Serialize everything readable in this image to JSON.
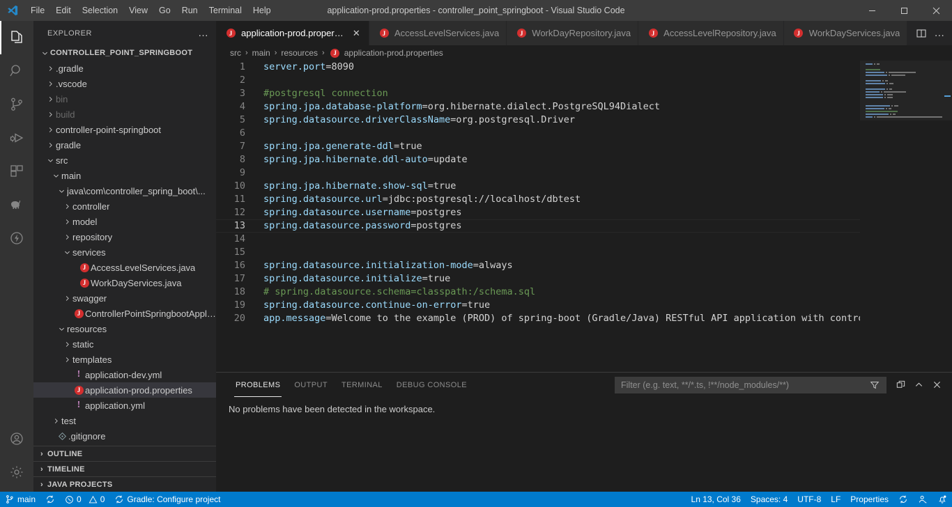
{
  "window": {
    "title": "application-prod.properties - controller_point_springboot - Visual Studio Code",
    "minimize_label": "─",
    "maximize_label": "❐",
    "close_label": "✕"
  },
  "menu": {
    "items": [
      {
        "label": "File",
        "name": "menu-file"
      },
      {
        "label": "Edit",
        "name": "menu-edit"
      },
      {
        "label": "Selection",
        "name": "menu-selection"
      },
      {
        "label": "View",
        "name": "menu-view"
      },
      {
        "label": "Go",
        "name": "menu-go"
      },
      {
        "label": "Run",
        "name": "menu-run"
      },
      {
        "label": "Terminal",
        "name": "menu-terminal"
      },
      {
        "label": "Help",
        "name": "menu-help"
      }
    ]
  },
  "activitybar": {
    "top": [
      {
        "icon": "explorer-icon",
        "active": true
      },
      {
        "icon": "search-icon",
        "active": false
      },
      {
        "icon": "source-control-icon",
        "active": false
      },
      {
        "icon": "run-and-debug-icon",
        "active": false
      },
      {
        "icon": "extensions-icon",
        "active": false
      },
      {
        "icon": "gradle-elephant-icon",
        "active": false
      },
      {
        "icon": "thunder-client-icon",
        "active": false
      }
    ],
    "bottom": [
      {
        "icon": "account-icon"
      },
      {
        "icon": "settings-gear-icon"
      }
    ]
  },
  "sidebar": {
    "title": "EXPLORER",
    "more_label": "…",
    "root": "CONTROLLER_POINT_SPRINGBOOT",
    "tree": [
      {
        "label": "CONTROLLER_POINT_SPRINGBOOT",
        "depth": 0,
        "type": "root",
        "expanded": true,
        "dim": false
      },
      {
        "label": ".gradle",
        "depth": 1,
        "type": "folder",
        "expanded": false,
        "dim": false
      },
      {
        "label": ".vscode",
        "depth": 1,
        "type": "folder",
        "expanded": false,
        "dim": false
      },
      {
        "label": "bin",
        "depth": 1,
        "type": "folder",
        "expanded": false,
        "dim": true
      },
      {
        "label": "build",
        "depth": 1,
        "type": "folder",
        "expanded": false,
        "dim": true
      },
      {
        "label": "controller-point-springboot",
        "depth": 1,
        "type": "folder",
        "expanded": false,
        "dim": false
      },
      {
        "label": "gradle",
        "depth": 1,
        "type": "folder",
        "expanded": false,
        "dim": false
      },
      {
        "label": "src",
        "depth": 1,
        "type": "folder",
        "expanded": true,
        "dim": false
      },
      {
        "label": "main",
        "depth": 2,
        "type": "folder",
        "expanded": true,
        "dim": false
      },
      {
        "label": "java\\com\\controller_spring_boot\\...",
        "depth": 3,
        "type": "folder",
        "expanded": true,
        "dim": false
      },
      {
        "label": "controller",
        "depth": 4,
        "type": "folder",
        "expanded": false,
        "dim": false
      },
      {
        "label": "model",
        "depth": 4,
        "type": "folder",
        "expanded": false,
        "dim": false
      },
      {
        "label": "repository",
        "depth": 4,
        "type": "folder",
        "expanded": false,
        "dim": false
      },
      {
        "label": "services",
        "depth": 4,
        "type": "folder",
        "expanded": true,
        "dim": false
      },
      {
        "label": "AccessLevelServices.java",
        "depth": 5,
        "type": "java",
        "expanded": false,
        "dim": false
      },
      {
        "label": "WorkDayServices.java",
        "depth": 5,
        "type": "java",
        "expanded": false,
        "dim": false
      },
      {
        "label": "swagger",
        "depth": 4,
        "type": "folder",
        "expanded": false,
        "dim": false
      },
      {
        "label": "ControllerPointSpringbootApplica...",
        "depth": 4,
        "type": "java",
        "expanded": false,
        "dim": false
      },
      {
        "label": "resources",
        "depth": 3,
        "type": "folder",
        "expanded": true,
        "dim": false
      },
      {
        "label": "static",
        "depth": 4,
        "type": "folder",
        "expanded": false,
        "dim": false
      },
      {
        "label": "templates",
        "depth": 4,
        "type": "folder",
        "expanded": false,
        "dim": false
      },
      {
        "label": "application-dev.yml",
        "depth": 4,
        "type": "yml",
        "expanded": false,
        "dim": false
      },
      {
        "label": "application-prod.properties",
        "depth": 4,
        "type": "java",
        "expanded": false,
        "dim": false,
        "selected": true
      },
      {
        "label": "application.yml",
        "depth": 4,
        "type": "yml",
        "expanded": false,
        "dim": false
      },
      {
        "label": "test",
        "depth": 2,
        "type": "folder",
        "expanded": false,
        "dim": false
      },
      {
        "label": ".gitignore",
        "depth": 1,
        "type": "git",
        "expanded": false,
        "dim": false
      }
    ],
    "sections": [
      {
        "label": "OUTLINE"
      },
      {
        "label": "TIMELINE"
      },
      {
        "label": "JAVA PROJECTS"
      }
    ]
  },
  "tabs": {
    "items": [
      {
        "label": "application-prod.properties",
        "icon": "java-file-icon",
        "active": true,
        "close_label": "✕"
      },
      {
        "label": "AccessLevelServices.java",
        "icon": "java-file-icon",
        "active": false
      },
      {
        "label": "WorkDayRepository.java",
        "icon": "java-file-icon",
        "active": false
      },
      {
        "label": "AccessLevelRepository.java",
        "icon": "java-file-icon",
        "active": false
      },
      {
        "label": "WorkDayServices.java",
        "icon": "java-file-icon",
        "active": false
      }
    ],
    "actions": [
      {
        "icon": "split-editor-icon"
      },
      {
        "icon": "more-actions-icon",
        "label": "…"
      }
    ]
  },
  "breadcrumbs": {
    "items": [
      "src",
      "main",
      "resources",
      "application-prod.properties"
    ],
    "separator": "›",
    "file_icon": "java-file-icon"
  },
  "editor": {
    "lines": [
      {
        "n": 1,
        "tokens": [
          {
            "t": "server.port",
            "c": "k"
          },
          {
            "t": "=",
            "c": "eq"
          },
          {
            "t": "8090",
            "c": "v"
          }
        ]
      },
      {
        "n": 2,
        "tokens": []
      },
      {
        "n": 3,
        "tokens": [
          {
            "t": "#postgresql connection",
            "c": "cm"
          }
        ]
      },
      {
        "n": 4,
        "tokens": [
          {
            "t": "spring.jpa.database-platform",
            "c": "k"
          },
          {
            "t": "=",
            "c": "eq"
          },
          {
            "t": "org.hibernate.dialect.PostgreSQL94Dialect",
            "c": "v"
          }
        ]
      },
      {
        "n": 5,
        "tokens": [
          {
            "t": "spring.datasource.driverClassName",
            "c": "k"
          },
          {
            "t": "=",
            "c": "eq"
          },
          {
            "t": "org.postgresql.Driver",
            "c": "v"
          }
        ]
      },
      {
        "n": 6,
        "tokens": []
      },
      {
        "n": 7,
        "tokens": [
          {
            "t": "spring.jpa.generate-ddl",
            "c": "k"
          },
          {
            "t": "=",
            "c": "eq"
          },
          {
            "t": "true",
            "c": "v"
          }
        ]
      },
      {
        "n": 8,
        "tokens": [
          {
            "t": "spring.jpa.hibernate.ddl-auto",
            "c": "k"
          },
          {
            "t": "=",
            "c": "eq"
          },
          {
            "t": "update",
            "c": "v"
          }
        ]
      },
      {
        "n": 9,
        "tokens": []
      },
      {
        "n": 10,
        "tokens": [
          {
            "t": "spring.jpa.hibernate.show-sql",
            "c": "k"
          },
          {
            "t": "=",
            "c": "eq"
          },
          {
            "t": "true",
            "c": "v"
          }
        ]
      },
      {
        "n": 11,
        "tokens": [
          {
            "t": "spring.datasource.url",
            "c": "k"
          },
          {
            "t": "=",
            "c": "eq"
          },
          {
            "t": "jdbc:postgresql://localhost/dbtest",
            "c": "v"
          }
        ]
      },
      {
        "n": 12,
        "tokens": [
          {
            "t": "spring.datasource.username",
            "c": "k"
          },
          {
            "t": "=",
            "c": "eq"
          },
          {
            "t": "postgres",
            "c": "v"
          }
        ]
      },
      {
        "n": 13,
        "tokens": [
          {
            "t": "spring.datasource.password",
            "c": "k"
          },
          {
            "t": "=",
            "c": "eq"
          },
          {
            "t": "postgres",
            "c": "v"
          }
        ],
        "current": true
      },
      {
        "n": 14,
        "tokens": []
      },
      {
        "n": 15,
        "tokens": []
      },
      {
        "n": 16,
        "tokens": [
          {
            "t": "spring.datasource.initialization-mode",
            "c": "k"
          },
          {
            "t": "=",
            "c": "eq"
          },
          {
            "t": "always",
            "c": "v"
          }
        ]
      },
      {
        "n": 17,
        "tokens": [
          {
            "t": "spring.datasource.initialize",
            "c": "k"
          },
          {
            "t": "=",
            "c": "eq"
          },
          {
            "t": "true",
            "c": "v"
          }
        ]
      },
      {
        "n": 18,
        "tokens": [
          {
            "t": "# spring.datasource.schema=classpath:/schema.sql",
            "c": "cm"
          }
        ]
      },
      {
        "n": 19,
        "tokens": [
          {
            "t": "spring.datasource.continue-on-error",
            "c": "k"
          },
          {
            "t": "=",
            "c": "eq"
          },
          {
            "t": "true",
            "c": "v"
          }
        ]
      },
      {
        "n": 20,
        "tokens": [
          {
            "t": "app.message",
            "c": "k"
          },
          {
            "t": "=",
            "c": "eq"
          },
          {
            "t": "Welcome to the example (PROD) of spring-boot (Gradle/Java) RESTful API application with controllers",
            "c": "v"
          }
        ]
      }
    ]
  },
  "panel": {
    "tabs": [
      {
        "label": "PROBLEMS",
        "active": true
      },
      {
        "label": "OUTPUT",
        "active": false
      },
      {
        "label": "TERMINAL",
        "active": false
      },
      {
        "label": "DEBUG CONSOLE",
        "active": false
      }
    ],
    "filter_placeholder": "Filter (e.g. text, **/*.ts, !**/node_modules/**)",
    "filter_value": "",
    "actions": [
      {
        "icon": "filter-icon"
      },
      {
        "icon": "maximize-panel-icon"
      },
      {
        "icon": "chevron-up-icon"
      },
      {
        "icon": "close-icon"
      }
    ],
    "message": "No problems have been detected in the workspace."
  },
  "statusbar": {
    "branch": "main",
    "sync_icon": "sync-icon",
    "errors": "0",
    "warnings": "0",
    "task": "Gradle: Configure project",
    "cursor": "Ln 13, Col 36",
    "spaces": "Spaces: 4",
    "encoding": "UTF-8",
    "eol": "LF",
    "language": "Properties",
    "right_icons": [
      "sync-status-icon",
      "live-share-icon",
      "bell-icon"
    ]
  },
  "colors": {
    "accent": "#007acc",
    "titlebar_bg": "#3c3c3c",
    "activitybar_bg": "#333333",
    "sidebar_bg": "#252526",
    "editor_bg": "#1e1e1e",
    "java_icon": "#d32f2f",
    "yml_icon": "#c586c0",
    "key_token": "#9cdcfe",
    "comment_token": "#6a9955",
    "value_token": "#d4d4d4"
  }
}
